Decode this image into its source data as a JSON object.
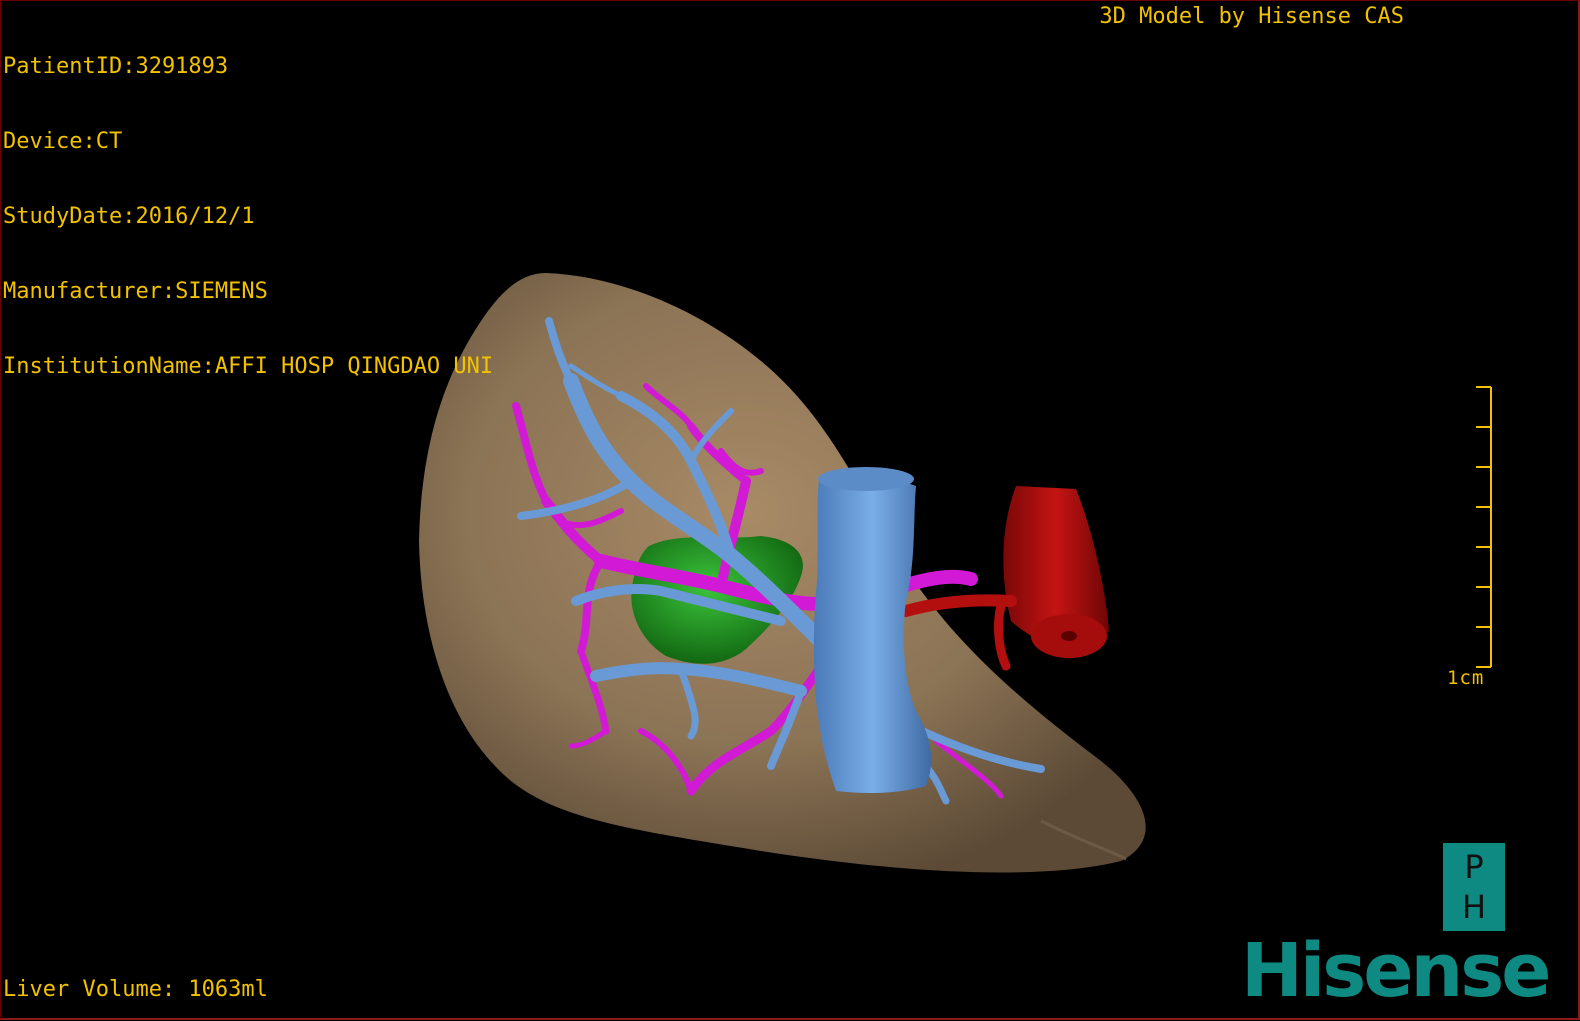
{
  "patient_info": {
    "patient_id": "PatientID:3291893",
    "device": "Device:CT",
    "study_date": "StudyDate:2016/12/1",
    "manufacturer": "Manufacturer:SIEMENS",
    "institution": "InstitutionName:AFFI HOSP QINGDAO UNI"
  },
  "credit": "3D Model by Hisense CAS",
  "liver_volume": "Liver Volume: 1063ml",
  "scale_bar": {
    "label": "1cm",
    "ticks": 8
  },
  "branding": {
    "badge_top": "P",
    "badge_bottom": "H",
    "logo": "Hisense"
  },
  "colors": {
    "text": "#f2c200",
    "liver": "#8b7355",
    "portal_vein": "#5b8fd0",
    "hepatic_artery": "#d21ad6",
    "tumor": "#1f9e1f",
    "aorta": "#b30f0f",
    "brand": "#0e8a82"
  }
}
